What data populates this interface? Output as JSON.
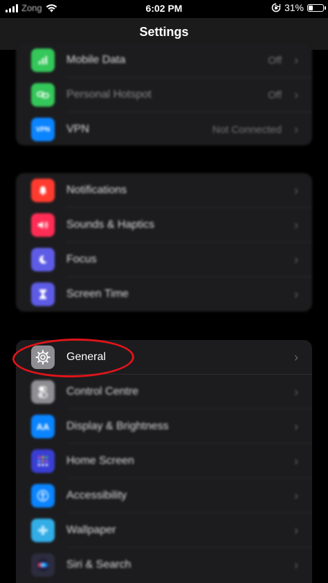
{
  "status_bar": {
    "carrier": "Zong",
    "time": "6:02 PM",
    "battery_percent": "31%",
    "battery_level": 0.31,
    "icons": [
      "signal-icon",
      "wifi-icon",
      "rotation-lock-icon",
      "battery-icon"
    ]
  },
  "nav": {
    "title": "Settings"
  },
  "groups": [
    {
      "rows": [
        {
          "label": "Mobile Data",
          "value": "Off",
          "icon": "antenna-icon",
          "color": "#34c759"
        },
        {
          "label": "Personal Hotspot",
          "value": "Off",
          "icon": "link-icon",
          "color": "#34c759"
        },
        {
          "label": "VPN",
          "value": "Not Connected",
          "icon": "vpn-icon",
          "icon_text": "VPN",
          "color": "#0a84ff"
        }
      ]
    },
    {
      "rows": [
        {
          "label": "Notifications",
          "icon": "bell-icon",
          "color": "#ff3b30"
        },
        {
          "label": "Sounds & Haptics",
          "icon": "speaker-icon",
          "color": "#ff2d55"
        },
        {
          "label": "Focus",
          "icon": "moon-icon",
          "color": "#5e5ce6"
        },
        {
          "label": "Screen Time",
          "icon": "hourglass-icon",
          "color": "#5e5ce6"
        }
      ]
    },
    {
      "rows": [
        {
          "label": "General",
          "icon": "gear-icon",
          "color": "#8e8e93"
        },
        {
          "label": "Control Centre",
          "icon": "switches-icon",
          "color": "#8e8e93"
        },
        {
          "label": "Display & Brightness",
          "icon": "text-size-icon",
          "icon_text": "AA",
          "color": "#0a84ff"
        },
        {
          "label": "Home Screen",
          "icon": "app-grid-icon",
          "color": "#3a3fd4"
        },
        {
          "label": "Accessibility",
          "icon": "accessibility-icon",
          "color": "#0a84ff"
        },
        {
          "label": "Wallpaper",
          "icon": "flower-icon",
          "color": "#32ade6"
        },
        {
          "label": "Siri & Search",
          "icon": "siri-icon",
          "color": "#2c2c3e"
        }
      ]
    }
  ],
  "annotation": {
    "ring_color": "#e0141a"
  }
}
